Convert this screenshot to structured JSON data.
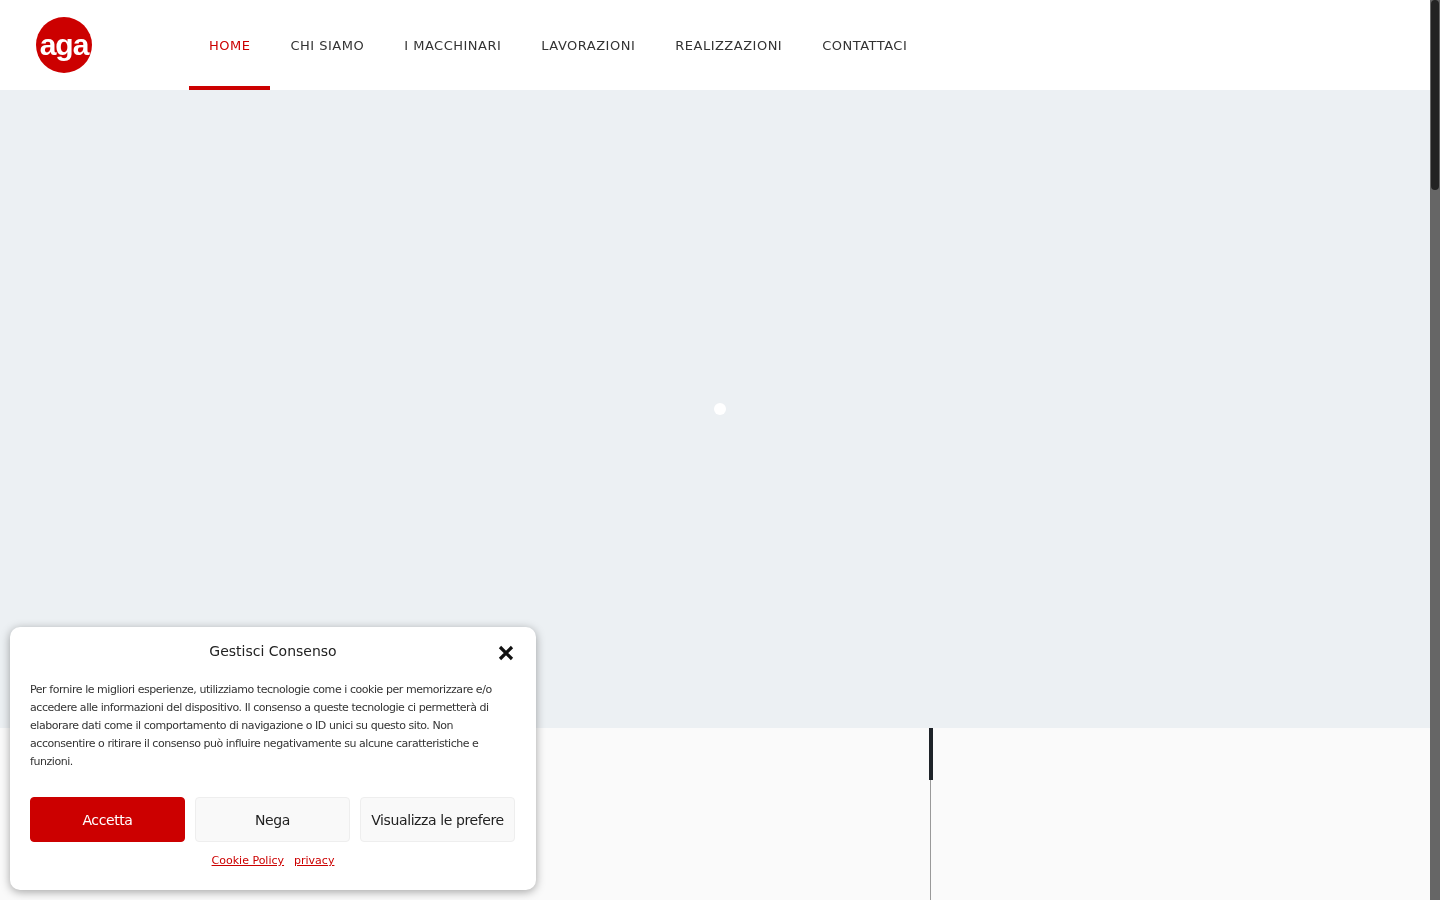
{
  "header": {
    "logo": "aga",
    "nav": [
      {
        "label": "HOME",
        "selected": true
      },
      {
        "label": "CHI SIAMO",
        "selected": false
      },
      {
        "label": "I MACCHINARI",
        "selected": false
      },
      {
        "label": "LAVORAZIONI",
        "selected": false
      },
      {
        "label": "REALIZZAZIONI",
        "selected": false
      },
      {
        "label": "CONTATTACI",
        "selected": false
      }
    ]
  },
  "cookie_dialog": {
    "title": "Gestisci Consenso",
    "text": "Per fornire le migliori esperienze, utilizziamo tecnologie come i cookie per memorizzare e/o accedere alle informazioni del dispositivo. Il consenso a queste tecnologie ci permetterà di elaborare dati come il comportamento di navigazione o ID unici su questo sito. Non acconsentire o ritirare il consenso può influire negativamente su alcune caratteristiche e funzioni.",
    "buttons": [
      {
        "label": "Accetta",
        "kind": "primary"
      },
      {
        "label": "Nega",
        "kind": "secondary"
      },
      {
        "label": "Visualizza le prefere",
        "kind": "secondary"
      }
    ],
    "links": [
      "Cookie Policy",
      "privacy"
    ]
  }
}
